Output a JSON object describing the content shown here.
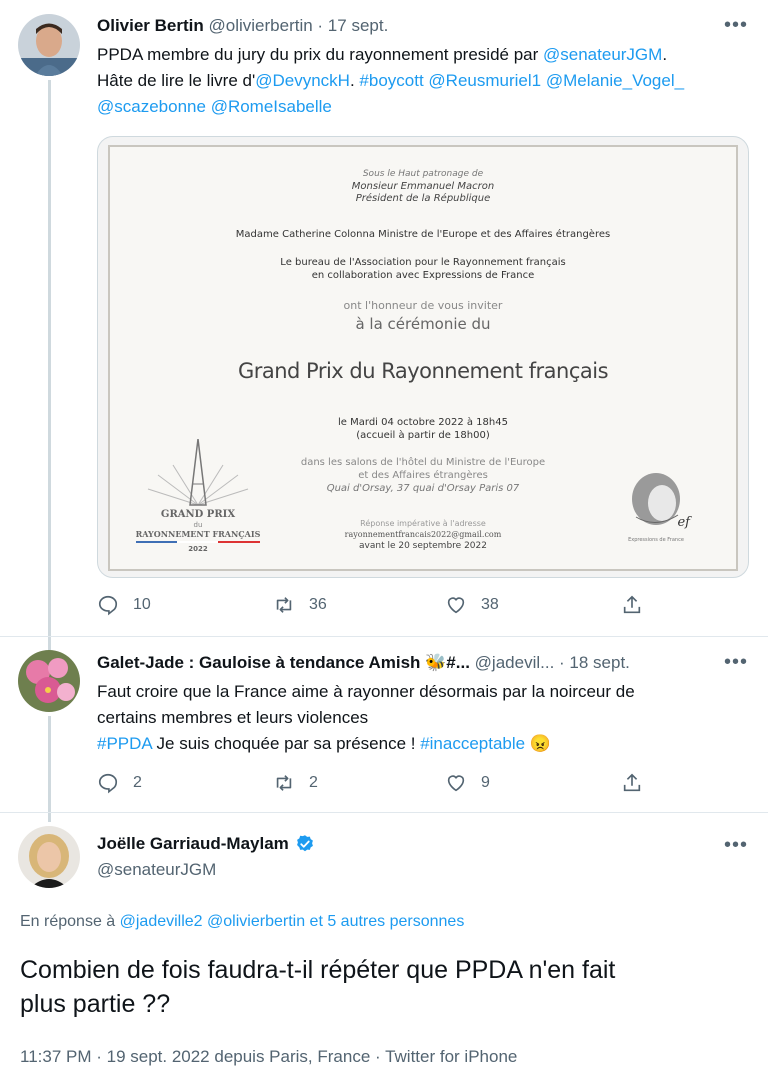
{
  "tweet1": {
    "name": "Olivier Bertin",
    "handle": "@olivierbertin",
    "date": "· 17 sept.",
    "line1_text": "PPDA membre du jury du prix du rayonnement presidé par ",
    "line1_mention": "@senateurJGM",
    "line1_end": ".",
    "line2_text": "Hâte de lire le livre d'",
    "line2_mention1": "@DevynckH",
    "line2_sep": ". ",
    "line2_hashtag": "#boycott",
    "line2_mention2": "@Reusmuriel1",
    "line2_mention3": "@Melanie_Vogel_",
    "line3_mention1": "@scazebonne",
    "line3_mention2": "@RomeIsabelle",
    "replies": "10",
    "retweets": "36",
    "likes": "38"
  },
  "invitation": {
    "patronage": "Sous le Haut patronage de",
    "president_name": "Monsieur Emmanuel Macron",
    "president_title": "Président de la République",
    "minister": "Madame Catherine Colonna Ministre de l'Europe et des Affaires étrangères",
    "bureau1": "Le bureau de l'Association pour le Rayonnement français",
    "bureau2": "en collaboration avec Expressions de France",
    "honour": "ont l'honneur de vous inviter",
    "ceremony": "à la cérémonie du",
    "prize_title": "Grand Prix du Rayonnement français",
    "date_line": "le Mardi 04 octobre 2022 à 18h45",
    "welcome": "(accueil à partir de 18h00)",
    "venue1": "dans les salons de l'hôtel du Ministre de l'Europe",
    "venue2": "et des Affaires étrangères",
    "address": "Quai d'Orsay, 37 quai d'Orsay Paris 07",
    "rsvp1": "Réponse impérative à l'adresse",
    "rsvp_email": "rayonnementfrancais2022@gmail.com",
    "rsvp_deadline": "avant le 20 septembre 2022",
    "logo_line1": "GRAND PRIX",
    "logo_line2": "du",
    "logo_line3": "RAYONNEMENT FRANÇAIS",
    "logo_year": "2022",
    "partner_logo": "ef",
    "partner_name": "Expressions de France"
  },
  "tweet2": {
    "name": "Galet-Jade : Gauloise à tendance Amish 🐝#...",
    "handle": "@jadevil...",
    "date": "· 18 sept.",
    "line1": "Faut croire que la France aime à rayonner désormais par la noirceur de",
    "line2": "certains membres et leurs violences",
    "hashtag1": "#PPDA",
    "line3_mid": " Je suis choquée par sa présence ! ",
    "hashtag2": "#inacceptable",
    "emoji": "😠",
    "replies": "2",
    "retweets": "2",
    "likes": "9"
  },
  "tweet3": {
    "name": "Joëlle Garriaud-Maylam",
    "handle": "@senateurJGM",
    "reply_prefix": "En réponse à ",
    "reply_mention1": "@jadeville2",
    "reply_mention2": "@olivierbertin",
    "reply_others": "et 5 autres personnes",
    "text_line1": "Combien de fois faudra-t-il répéter que PPDA n'en fait",
    "text_line2": "plus partie ??",
    "meta": "11:37 PM · 19 sept. 2022 depuis Paris, France · Twitter for iPhone"
  },
  "icons": {
    "more": "more-dots-icon",
    "reply": "reply-icon",
    "retweet": "retweet-icon",
    "like": "heart-icon",
    "share": "share-icon",
    "verified": "verified-badge-icon"
  },
  "colors": {
    "link": "#1d9bf0",
    "muted": "#536471",
    "verified": "#1d9bf0"
  }
}
